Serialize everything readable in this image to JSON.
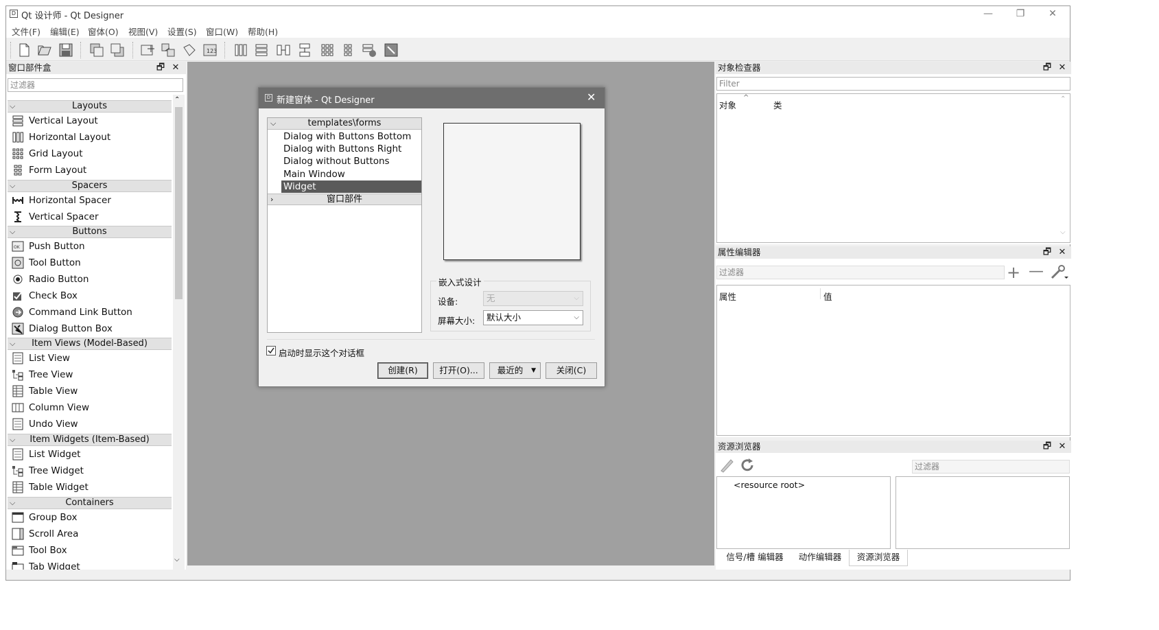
{
  "window": {
    "title": "Qt 设计师 - Qt Designer",
    "app_icon": "D",
    "min": "—",
    "restore": "❐",
    "close": "✕"
  },
  "menu": [
    "文件(F)",
    "编辑(E)",
    "窗体(O)",
    "视图(V)",
    "设置(S)",
    "窗口(W)",
    "帮助(H)"
  ],
  "widget_box": {
    "title": "窗口部件盒",
    "filter_placeholder": "过滤器",
    "categories": {
      "layouts": "Layouts",
      "spacers": "Spacers",
      "buttons": "Buttons",
      "item_views": "Item Views (Model-Based)",
      "item_widgets": "Item Widgets (Item-Based)",
      "containers": "Containers"
    },
    "items": {
      "vertical_layout": "Vertical Layout",
      "horizontal_layout": "Horizontal Layout",
      "grid_layout": "Grid Layout",
      "form_layout": "Form Layout",
      "horizontal_spacer": "Horizontal Spacer",
      "vertical_spacer": "Vertical Spacer",
      "push_button": "Push Button",
      "tool_button": "Tool Button",
      "radio_button": "Radio Button",
      "check_box": "Check Box",
      "command_link_button": "Command Link Button",
      "dialog_button_box": "Dialog Button Box",
      "list_view": "List View",
      "tree_view": "Tree View",
      "table_view": "Table View",
      "column_view": "Column View",
      "undo_view": "Undo View",
      "list_widget": "List Widget",
      "tree_widget": "Tree Widget",
      "table_widget": "Table Widget",
      "group_box": "Group Box",
      "scroll_area": "Scroll Area",
      "tool_box": "Tool Box",
      "tab_widget": "Tab Widget"
    }
  },
  "dialog": {
    "title": "新建窗体 - Qt Designer",
    "tree_header": "templates\\forms",
    "templates": [
      "Dialog with Buttons Bottom",
      "Dialog with Buttons Right",
      "Dialog without Buttons",
      "Main Window",
      "Widget"
    ],
    "selected_template": "Widget",
    "widgets_header": "窗口部件",
    "embedded_group": "嵌入式设计",
    "device_label": "设备:",
    "device_value": "无",
    "screen_label": "屏幕大小:",
    "screen_value": "默认大小",
    "show_on_startup": "启动时显示这个对话框",
    "show_on_startup_checked": true,
    "buttons": {
      "create": "创建(R)",
      "open": "打开(O)...",
      "recent": "最近的",
      "close": "关闭(C)"
    }
  },
  "object_inspector": {
    "title": "对象检查器",
    "filter_placeholder": "Filter",
    "col_object": "对象",
    "col_class": "类"
  },
  "property_editor": {
    "title": "属性编辑器",
    "filter_placeholder": "过滤器",
    "col_property": "属性",
    "col_value": "值"
  },
  "resource_browser": {
    "title": "资源浏览器",
    "filter_placeholder": "过滤器",
    "root": "<resource root>"
  },
  "bottom_tabs": [
    "信号/槽 编辑器",
    "动作编辑器",
    "资源浏览器"
  ],
  "active_bottom_tab": "资源浏览器"
}
